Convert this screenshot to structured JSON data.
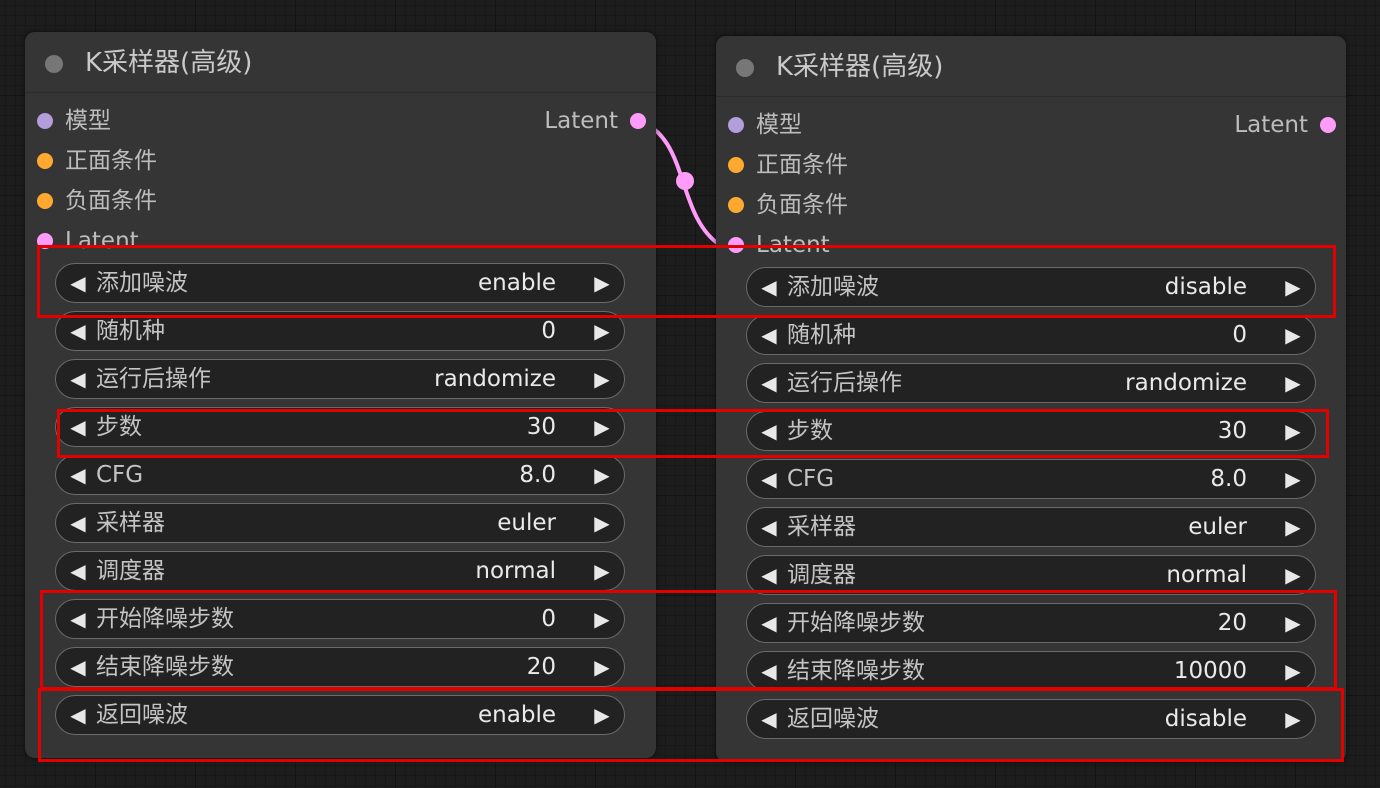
{
  "colors": {
    "canvas_bg": "#1d1d1d",
    "node_bg": "#353535",
    "widget_bg": "#222222",
    "model_slot": "#b39ddb",
    "conditioning_slot": "#ffa931",
    "latent_slot": "#ff9cf9",
    "highlight": "#e30000"
  },
  "nodes": [
    {
      "title": "K采样器(高级)",
      "inputs": [
        {
          "label": "模型",
          "type": "model"
        },
        {
          "label": "正面条件",
          "type": "conditioning"
        },
        {
          "label": "负面条件",
          "type": "conditioning"
        },
        {
          "label": "Latent",
          "type": "latent"
        }
      ],
      "output": {
        "label": "Latent",
        "type": "latent"
      },
      "widgets": [
        {
          "label": "添加噪波",
          "value": "enable"
        },
        {
          "label": "随机种",
          "value": "0"
        },
        {
          "label": "运行后操作",
          "value": "randomize"
        },
        {
          "label": "步数",
          "value": "30"
        },
        {
          "label": "CFG",
          "value": "8.0"
        },
        {
          "label": "采样器",
          "value": "euler"
        },
        {
          "label": "调度器",
          "value": "normal"
        },
        {
          "label": "开始降噪步数",
          "value": "0"
        },
        {
          "label": "结束降噪步数",
          "value": "20"
        },
        {
          "label": "返回噪波",
          "value": "enable"
        }
      ]
    },
    {
      "title": "K采样器(高级)",
      "inputs": [
        {
          "label": "模型",
          "type": "model"
        },
        {
          "label": "正面条件",
          "type": "conditioning"
        },
        {
          "label": "负面条件",
          "type": "conditioning"
        },
        {
          "label": "Latent",
          "type": "latent"
        }
      ],
      "output": {
        "label": "Latent",
        "type": "latent"
      },
      "widgets": [
        {
          "label": "添加噪波",
          "value": "disable"
        },
        {
          "label": "随机种",
          "value": "0"
        },
        {
          "label": "运行后操作",
          "value": "randomize"
        },
        {
          "label": "步数",
          "value": "30"
        },
        {
          "label": "CFG",
          "value": "8.0"
        },
        {
          "label": "采样器",
          "value": "euler"
        },
        {
          "label": "调度器",
          "value": "normal"
        },
        {
          "label": "开始降噪步数",
          "value": "20"
        },
        {
          "label": "结束降噪步数",
          "value": "10000"
        },
        {
          "label": "返回噪波",
          "value": "disable"
        }
      ]
    }
  ],
  "arrow_left_glyph": "◀",
  "arrow_right_glyph": "▶"
}
